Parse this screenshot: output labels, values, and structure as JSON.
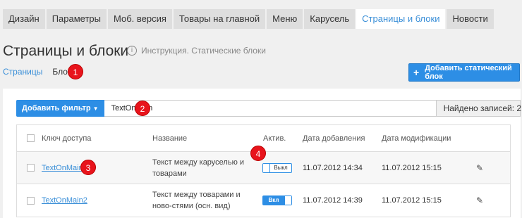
{
  "tabs": [
    {
      "label": "Дизайн"
    },
    {
      "label": "Параметры"
    },
    {
      "label": "Моб. версия"
    },
    {
      "label": "Товары на главной"
    },
    {
      "label": "Меню"
    },
    {
      "label": "Карусель"
    },
    {
      "label": "Страницы и блоки",
      "active": true
    },
    {
      "label": "Новости"
    }
  ],
  "page": {
    "title": "Страницы и блоки",
    "instruction": "Инструкция. Статические блоки"
  },
  "subnav": {
    "pages": "Страницы",
    "blocks": "Блоки"
  },
  "add_button": {
    "label": "Добавить статический блок",
    "icon": "plus-icon"
  },
  "filter": {
    "button_label": "Добавить фильтр",
    "value": "TextOnMain",
    "found": "Найдено записей: 2"
  },
  "table": {
    "headers": {
      "key": "Ключ доступа",
      "name": "Название",
      "active": "Актив.",
      "added": "Дата добавления",
      "modified": "Дата модификации"
    },
    "rows": [
      {
        "key": "TextOnMain",
        "name": "Текст между каруселью и товарами",
        "active": false,
        "toggle_label": "Выкл",
        "added": "11.07.2012 14:34",
        "modified": "11.07.2012 15:15"
      },
      {
        "key": "TextOnMain2",
        "name": "Текст между товарами и ново-стями (осн. вид)",
        "active": true,
        "toggle_label": "Вкл",
        "added": "11.07.2012 14:39",
        "modified": "11.07.2012 15:15"
      }
    ]
  },
  "annotations": [
    "1",
    "2",
    "3",
    "4"
  ],
  "colors": {
    "accent": "#2d8ee5",
    "badge": "#e8141c"
  }
}
